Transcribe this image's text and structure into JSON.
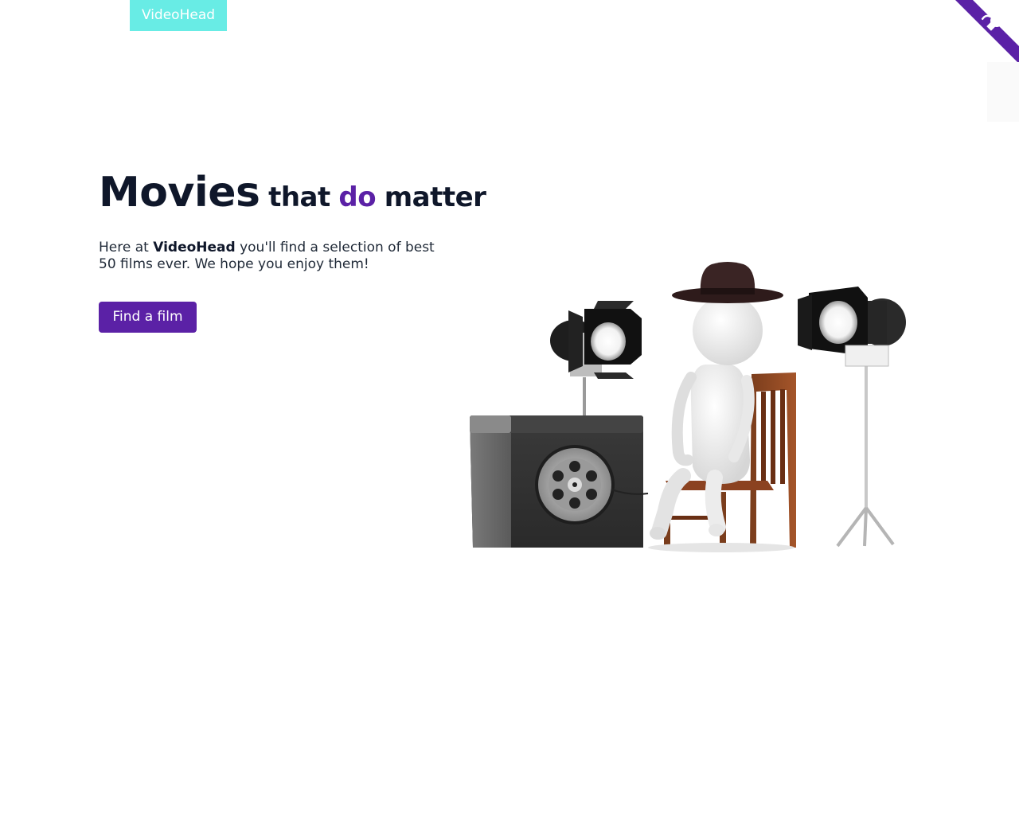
{
  "header": {
    "logo_text": "VideoHead"
  },
  "corner_link": {
    "icon": "github-octocat-icon",
    "color": "#5b21a6"
  },
  "hero": {
    "title_word_1": "Movies",
    "title_word_2": "that",
    "title_word_3": "do",
    "title_word_4": "matter",
    "intro_prefix": "Here at ",
    "intro_brand": "VideoHead",
    "intro_suffix": " you'll find a selection of best 50 films ever. We hope you enjoy them!",
    "cta_label": "Find a film",
    "illustration_icon": "film-director-illustration"
  },
  "colors": {
    "accent": "#5b21a6",
    "logo_bg": "#68ece5",
    "heading": "#0f172a"
  }
}
